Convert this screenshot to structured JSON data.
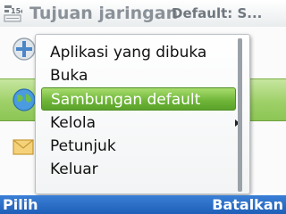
{
  "titlebar": {
    "title": "Tujuan jaringan",
    "right_text": "Default: S...",
    "icon": "menu-grid-icon"
  },
  "background_list": {
    "items": [
      {
        "icon": "globe-pin-icon"
      },
      {
        "icon": "globe-icon",
        "selected": true
      },
      {
        "icon": "envelope-icon"
      }
    ]
  },
  "menu": {
    "items": [
      {
        "label": "Aplikasi yang dibuka"
      },
      {
        "label": "Buka"
      },
      {
        "label": "Sambungan default",
        "selected": true
      },
      {
        "label": "Kelola",
        "has_submenu": true
      },
      {
        "label": "Petunjuk"
      },
      {
        "label": "Keluar"
      }
    ],
    "scroll_fraction_visible": 1.0
  },
  "softkeys": {
    "left": "Pilih",
    "right": "Batalkan"
  },
  "colors": {
    "selection_green": "#6db437",
    "softkey_blue": "#1f5fb8",
    "title_gray": "#8a9198"
  }
}
